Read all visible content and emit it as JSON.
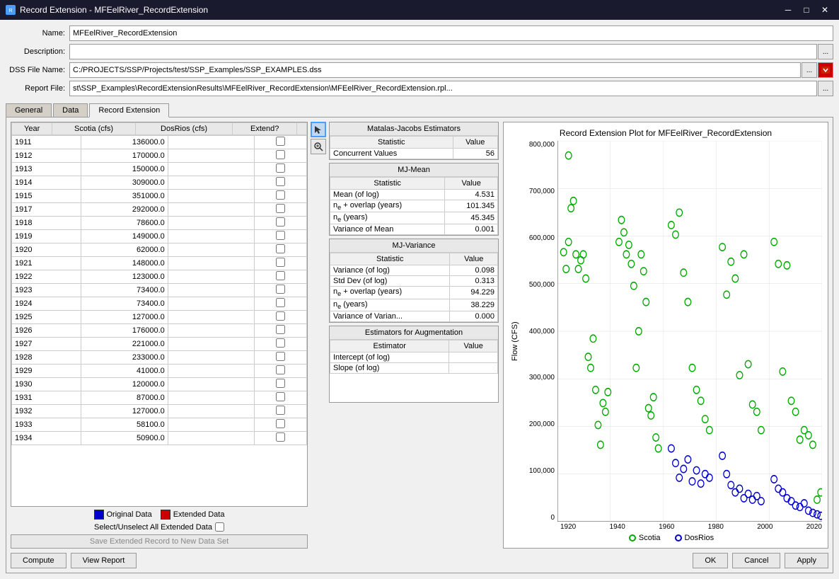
{
  "titleBar": {
    "title": "Record Extension - MFEelRiver_RecordExtension",
    "icon": "RE"
  },
  "form": {
    "nameLabel": "Name:",
    "nameValue": "MFEelRiver_RecordExtension",
    "descLabel": "Description:",
    "descValue": "",
    "dssLabel": "DSS File Name:",
    "dssValue": "C:/PROJECTS/SSP/Projects/test/SSP_Examples/SSP_EXAMPLES.dss",
    "reportLabel": "Report File:",
    "reportValue": "st\\SSP_Examples\\RecordExtensionResults\\MFEelRiver_RecordExtension\\MFEelRiver_RecordExtension.rpl..."
  },
  "tabs": {
    "items": [
      "General",
      "Data",
      "Record Extension"
    ],
    "active": "Record Extension"
  },
  "table": {
    "headers": [
      "Year",
      "Scotia (cfs)",
      "DosRios (cfs)",
      "Extend?"
    ],
    "rows": [
      {
        "year": "1911",
        "scotia": "136000.0",
        "dosrios": "",
        "extend": false
      },
      {
        "year": "1912",
        "scotia": "170000.0",
        "dosrios": "",
        "extend": false
      },
      {
        "year": "1913",
        "scotia": "150000.0",
        "dosrios": "",
        "extend": false
      },
      {
        "year": "1914",
        "scotia": "309000.0",
        "dosrios": "",
        "extend": false
      },
      {
        "year": "1915",
        "scotia": "351000.0",
        "dosrios": "",
        "extend": false
      },
      {
        "year": "1917",
        "scotia": "292000.0",
        "dosrios": "",
        "extend": false
      },
      {
        "year": "1918",
        "scotia": "78600.0",
        "dosrios": "",
        "extend": false
      },
      {
        "year": "1919",
        "scotia": "149000.0",
        "dosrios": "",
        "extend": false
      },
      {
        "year": "1920",
        "scotia": "62000.0",
        "dosrios": "",
        "extend": false
      },
      {
        "year": "1921",
        "scotia": "148000.0",
        "dosrios": "",
        "extend": false
      },
      {
        "year": "1922",
        "scotia": "123000.0",
        "dosrios": "",
        "extend": false
      },
      {
        "year": "1923",
        "scotia": "73400.0",
        "dosrios": "",
        "extend": false
      },
      {
        "year": "1924",
        "scotia": "73400.0",
        "dosrios": "",
        "extend": false
      },
      {
        "year": "1925",
        "scotia": "127000.0",
        "dosrios": "",
        "extend": false
      },
      {
        "year": "1926",
        "scotia": "176000.0",
        "dosrios": "",
        "extend": false
      },
      {
        "year": "1927",
        "scotia": "221000.0",
        "dosrios": "",
        "extend": false
      },
      {
        "year": "1928",
        "scotia": "233000.0",
        "dosrios": "",
        "extend": false
      },
      {
        "year": "1929",
        "scotia": "41000.0",
        "dosrios": "",
        "extend": false
      },
      {
        "year": "1930",
        "scotia": "120000.0",
        "dosrios": "",
        "extend": false
      },
      {
        "year": "1931",
        "scotia": "87000.0",
        "dosrios": "",
        "extend": false
      },
      {
        "year": "1932",
        "scotia": "127000.0",
        "dosrios": "",
        "extend": false
      },
      {
        "year": "1933",
        "scotia": "58100.0",
        "dosrios": "",
        "extend": false
      },
      {
        "year": "1934",
        "scotia": "50900.0",
        "dosrios": "",
        "extend": false
      }
    ]
  },
  "legend": {
    "originalLabel": "Original Data",
    "extendedLabel": "Extended Data",
    "selectLabel": "Select/Unselect All Extended Data"
  },
  "buttons": {
    "saveExtended": "Save Extended Record to New Data Set",
    "compute": "Compute",
    "viewReport": "View Report",
    "ok": "OK",
    "cancel": "Cancel",
    "apply": "Apply"
  },
  "mjEstimators": {
    "title": "Matalas-Jacobs Estimators",
    "statHeader": "Statistic",
    "valHeader": "Value",
    "concurrentLabel": "Concurrent Values",
    "concurrentValue": "56"
  },
  "mjMean": {
    "title": "MJ-Mean",
    "statHeader": "Statistic",
    "valHeader": "Value",
    "rows": [
      {
        "stat": "Mean (of log)",
        "val": "4.531"
      },
      {
        "stat": "nₑ + overlap (years)",
        "val": "101.345"
      },
      {
        "stat": "nₑ (years)",
        "val": "45.345"
      },
      {
        "stat": "Variance of Mean",
        "val": "0.001"
      }
    ]
  },
  "mjVariance": {
    "title": "MJ-Variance",
    "statHeader": "Statistic",
    "valHeader": "Value",
    "rows": [
      {
        "stat": "Variance (of log)",
        "val": "0.098"
      },
      {
        "stat": "Std Dev (of log)",
        "val": "0.313"
      },
      {
        "stat": "nₑ + overlap (years)",
        "val": "94.229"
      },
      {
        "stat": "nₑ (years)",
        "val": "38.229"
      },
      {
        "stat": "Variance of Varian...",
        "val": "0.000"
      }
    ]
  },
  "augmentation": {
    "title": "Estimators for Augmentation",
    "estimatorHeader": "Estimator",
    "valHeader": "Value",
    "rows": [
      {
        "est": "Intercept (of log)",
        "val": ""
      },
      {
        "est": "Slope (of log)",
        "val": ""
      }
    ]
  },
  "chart": {
    "title": "Record Extension Plot for MFEelRiver_RecordExtension",
    "yLabel": "Flow (CFS)",
    "yAxis": [
      "800,000",
      "700,000",
      "600,000",
      "500,000",
      "400,000",
      "300,000",
      "200,000",
      "100,000",
      "0"
    ],
    "xAxis": [
      "1920",
      "1940",
      "1960",
      "1980",
      "2000",
      "2020"
    ],
    "scotiaLabel": "Scotia",
    "dosriosLabel": "DosRios",
    "scotiaColor": "#00aa00",
    "dosriosColor": "#0000cc"
  }
}
